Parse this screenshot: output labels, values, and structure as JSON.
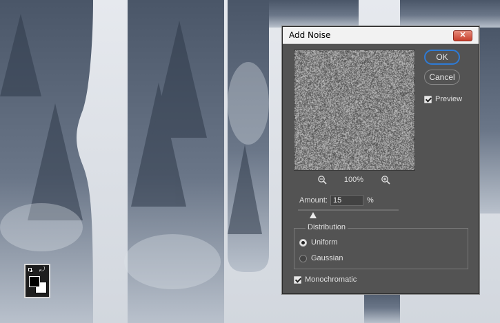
{
  "dialog": {
    "title": "Add Noise",
    "close_label": "✕",
    "ok_label": "OK",
    "cancel_label": "Cancel",
    "preview_label": "Preview",
    "preview_checked": true,
    "zoom_level": "100%",
    "amount_label": "Amount:",
    "amount_value": "15",
    "amount_unit": "%",
    "amount_fraction": 0.15,
    "distribution_label": "Distribution",
    "distribution_options": [
      "Uniform",
      "Gaussian"
    ],
    "distribution_selected": "Uniform",
    "monochromatic_label": "Monochromatic",
    "monochromatic_checked": true
  },
  "colors": {
    "dialog_bg": "#535353",
    "ok_border": "#2e7bd6",
    "close_button": "#c8402e",
    "foreground_swatch": "#000000",
    "background_swatch": "#ffffff"
  },
  "icons": {
    "zoom_out": "zoom-out-icon",
    "zoom_in": "zoom-in-icon",
    "swap_colors": "swap-colors-icon",
    "default_colors": "default-colors-icon"
  }
}
